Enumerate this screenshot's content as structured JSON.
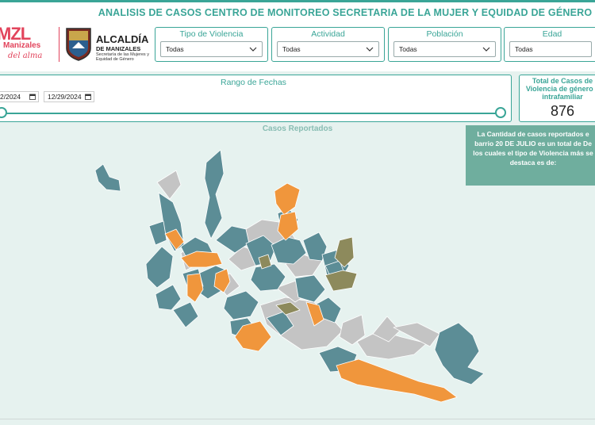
{
  "title": "ANALISIS DE CASOS CENTRO DE MONITOREO SECRETARIA DE LA MUJER Y EQUIDAD DE GÉNERO",
  "logo_left": {
    "brand": "MZL",
    "line": "Manizales",
    "tagline": "del alma"
  },
  "logo_right": {
    "title": "ALCALDÍA",
    "subtitle": "DE MANIZALES",
    "detail": "Secretaría de las Mujeres y Equidad de Género"
  },
  "filters": [
    {
      "label": "Tipo de Violencia",
      "value": "Todas"
    },
    {
      "label": "Actividad",
      "value": "Todas"
    },
    {
      "label": "Población",
      "value": "Todas"
    },
    {
      "label": "Edad",
      "value": "Todas"
    }
  ],
  "date_range": {
    "label": "Rango de Fechas",
    "start": "2/2024",
    "end": "12/29/2024",
    "slider_start": 0.0,
    "slider_end": 1.0
  },
  "kpi": {
    "label": "Total de Casos de Violencia de género e intrafamiliar",
    "value": "876"
  },
  "map": {
    "title": "Casos Reportados",
    "colors": {
      "teal": "#5c8d96",
      "orange": "#f0963c",
      "olive": "#8d8a5c",
      "gray": "#c4c4c4"
    }
  },
  "tooltip": {
    "text": "La Cantidad de casos reportados e barrio 20 DE JULIO es un total de De los cuales el tipo de Violencia más se destaca es de:"
  },
  "colors": {
    "accent": "#3aa597",
    "brand": "#e2445c",
    "tooltip_bg": "#6fae9e",
    "background": "#e6f2ef"
  }
}
